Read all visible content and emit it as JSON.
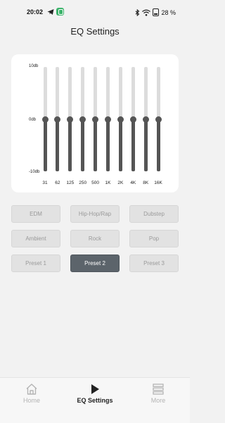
{
  "status_bar": {
    "time": "20:02",
    "battery": "28 %",
    "icons": [
      "telegram-icon",
      "app-notification-icon",
      "bluetooth-icon",
      "wifi-icon",
      "battery-icon"
    ]
  },
  "header": {
    "title": "EQ Settings"
  },
  "equalizer": {
    "db_labels": {
      "max": "10db",
      "mid": "0db",
      "min": "-10db"
    },
    "range_db": [
      -10,
      10
    ],
    "bands": [
      {
        "label": "31",
        "gain_db": 0
      },
      {
        "label": "62",
        "gain_db": 0
      },
      {
        "label": "125",
        "gain_db": 0
      },
      {
        "label": "250",
        "gain_db": 0
      },
      {
        "label": "500",
        "gain_db": 0
      },
      {
        "label": "1K",
        "gain_db": 0
      },
      {
        "label": "2K",
        "gain_db": 0
      },
      {
        "label": "4K",
        "gain_db": 0
      },
      {
        "label": "8K",
        "gain_db": 0
      },
      {
        "label": "16K",
        "gain_db": 0
      }
    ]
  },
  "presets": {
    "items": [
      "EDM",
      "Hip-Hop/Rap",
      "Dubstep",
      "Ambient",
      "Rock",
      "Pop",
      "Preset 1",
      "Preset 2",
      "Preset 3"
    ],
    "selected": "Preset 2"
  },
  "bottom_nav": {
    "items": [
      {
        "label": "Home",
        "icon": "home-icon"
      },
      {
        "label": "EQ Settings",
        "icon": "play-icon"
      },
      {
        "label": "More",
        "icon": "more-icon"
      }
    ],
    "active": "EQ Settings"
  },
  "colors": {
    "background": "#f2f2f2",
    "card": "#ffffff",
    "slider_active": "#555555",
    "slider_track": "#dcdcdc",
    "preset_selected": "#5c646b"
  }
}
